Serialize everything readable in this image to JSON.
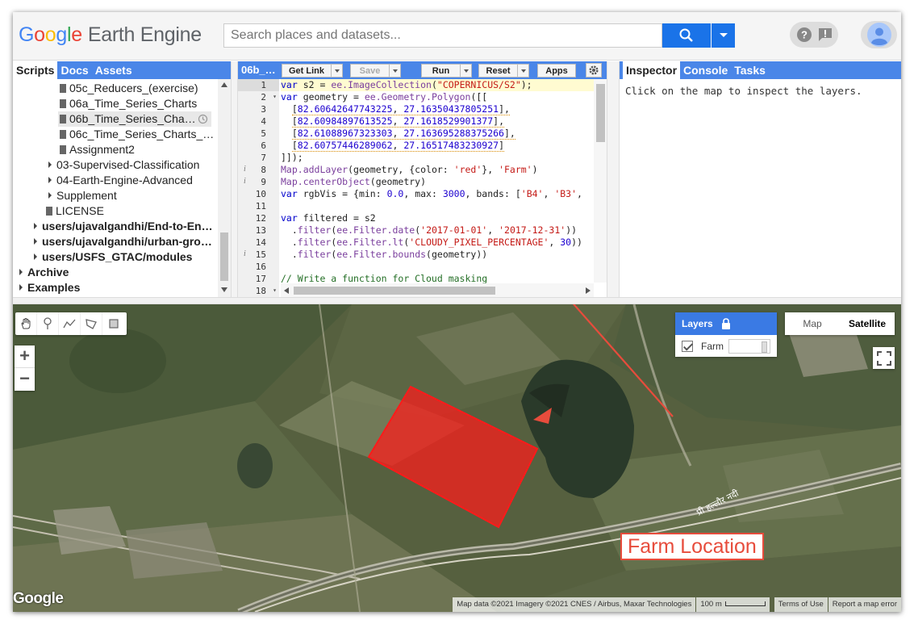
{
  "header": {
    "logo_google": [
      "G",
      "o",
      "o",
      "g",
      "l",
      "e"
    ],
    "logo_suffix": "Earth Engine",
    "search_placeholder": "Search places and datasets...",
    "help_icon": "help-icon",
    "feedback_icon": "feedback-icon",
    "account_icon": "account-icon"
  },
  "left_panel": {
    "tabs": [
      "Scripts",
      "Docs",
      "Assets"
    ],
    "active_tab": "Scripts",
    "tree": [
      {
        "label": "05c_Reducers_(exercise)",
        "type": "file"
      },
      {
        "label": "06a_Time_Series_Charts",
        "type": "file"
      },
      {
        "label": "06b_Time_Series_Cha…",
        "type": "file",
        "selected": true
      },
      {
        "label": "06c_Time_Series_Charts_…",
        "type": "file"
      },
      {
        "label": "Assignment2",
        "type": "file"
      },
      {
        "label": "03-Supervised-Classification",
        "type": "folder"
      },
      {
        "label": "04-Earth-Engine-Advanced",
        "type": "folder"
      },
      {
        "label": "Supplement",
        "type": "folder"
      },
      {
        "label": "LICENSE",
        "type": "file"
      },
      {
        "label": "users/ujavalgandhi/End-to-En…",
        "type": "repo"
      },
      {
        "label": "users/ujavalgandhi/urban-gro…",
        "type": "repo"
      },
      {
        "label": "users/USFS_GTAC/modules",
        "type": "repo"
      },
      {
        "label": "Archive",
        "type": "repo"
      },
      {
        "label": "Examples",
        "type": "repo"
      }
    ]
  },
  "editor": {
    "title": "06b_…",
    "buttons": {
      "get_link": "Get Link",
      "save": "Save",
      "run": "Run",
      "reset": "Reset",
      "apps": "Apps"
    },
    "line_numbers": [
      "1",
      "2",
      "3",
      "4",
      "5",
      "6",
      "7",
      "8",
      "9",
      "10",
      "11",
      "12",
      "13",
      "14",
      "15",
      "16",
      "17",
      "18"
    ],
    "code_text": [
      "var s2 = ee.ImageCollection(\"COPERNICUS/S2\");",
      "var geometry = ee.Geometry.Polygon([[",
      "  [82.60642647743225, 27.16350437805251],",
      "  [82.60984897613525, 27.1618529901377],",
      "  [82.61088967323303, 27.163695288375266],",
      "  [82.60757446289062, 27.16517483230927]",
      "]]);",
      "Map.addLayer(geometry, {color: 'red'}, 'Farm')",
      "Map.centerObject(geometry)",
      "var rgbVis = {min: 0.0, max: 3000, bands: ['B4', 'B3',",
      "",
      "var filtered = s2",
      "  .filter(ee.Filter.date('2017-01-01', '2017-12-31'))",
      "  .filter(ee.Filter.lt('CLOUDY_PIXEL_PERCENTAGE', 30))",
      "  .filter(ee.Filter.bounds(geometry))",
      "",
      "// Write a function for Cloud masking",
      ""
    ]
  },
  "right_panel": {
    "tabs": [
      "Inspector",
      "Console",
      "Tasks"
    ],
    "active_tab": "Inspector",
    "message": "Click on the map to inspect the layers."
  },
  "map": {
    "tools": [
      "hand-icon",
      "marker-icon",
      "line-icon",
      "polygon-icon",
      "rectangle-icon"
    ],
    "zoom_in": "+",
    "zoom_out": "−",
    "layers_title": "Layers",
    "layer_name": "Farm",
    "map_types": [
      "Map",
      "Satellite"
    ],
    "active_map_type": "Satellite",
    "river_label": "प्री हल्लौर नदी",
    "google_logo": "Google",
    "attribution": {
      "data": "Map data ©2021 Imagery ©2021 CNES / Airbus, Maxar Technologies",
      "scale": "100 m",
      "terms": "Terms of Use",
      "report": "Report a map error"
    },
    "farm_color": "#ff1a1a",
    "annotation": "Farm Location",
    "annotation_color": "#e74c3c"
  }
}
